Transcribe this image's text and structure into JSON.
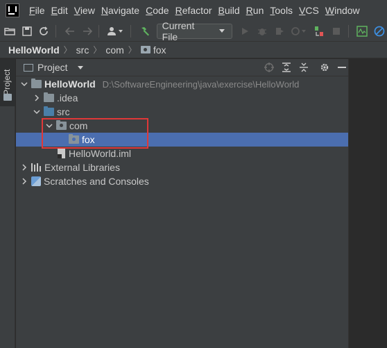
{
  "menubar": {
    "items": [
      {
        "label": "File",
        "ul": "F",
        "rest": "ile"
      },
      {
        "label": "Edit",
        "ul": "E",
        "rest": "dit"
      },
      {
        "label": "View",
        "ul": "V",
        "rest": "iew"
      },
      {
        "label": "Navigate",
        "ul": "N",
        "rest": "avigate"
      },
      {
        "label": "Code",
        "ul": "C",
        "rest": "ode"
      },
      {
        "label": "Refactor",
        "ul": "R",
        "rest": "efactor"
      },
      {
        "label": "Build",
        "ul": "B",
        "rest": "uild"
      },
      {
        "label": "Run",
        "ul": "R",
        "rest": "un"
      },
      {
        "label": "Tools",
        "ul": "T",
        "rest": "ools"
      },
      {
        "label": "VCS",
        "ul": "V",
        "rest": "CS"
      },
      {
        "label": "Window",
        "ul": "W",
        "rest": "indow"
      }
    ]
  },
  "toolbar": {
    "run_config": "Current File"
  },
  "breadcrumb": {
    "project": "HelloWorld",
    "items": [
      "src",
      "com",
      "fox"
    ]
  },
  "side_strip": {
    "project_tab": "Project"
  },
  "panel": {
    "title": "Project"
  },
  "tree": {
    "root": {
      "label": "HelloWorld",
      "path": "D:\\SoftwareEngineering\\java\\exercise\\HelloWorld"
    },
    "idea": ".idea",
    "src": "src",
    "com": "com",
    "fox": "fox",
    "iml": "HelloWorld.iml",
    "libs": "External Libraries",
    "scratches": "Scratches and Consoles"
  },
  "colors": {
    "selection": "#4b6eaf",
    "highlight_box": "#e03838",
    "background": "#3c3f41"
  }
}
